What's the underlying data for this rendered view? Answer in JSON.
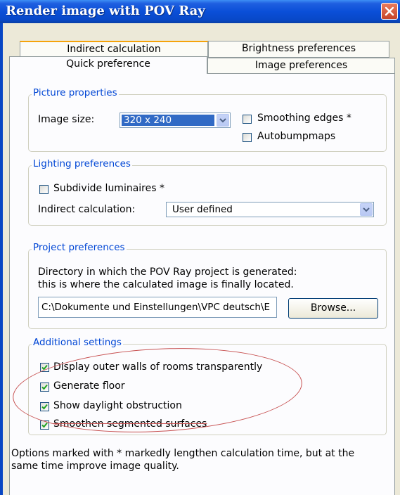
{
  "window": {
    "title": "Render image with POV Ray"
  },
  "tabs": {
    "row_back": [
      {
        "label": "Indirect calculation"
      },
      {
        "label": "Brightness preferences"
      }
    ],
    "row_front": [
      {
        "label": "Quick preference",
        "active": true
      },
      {
        "label": "Image preferences"
      }
    ]
  },
  "picture_properties": {
    "legend": "Picture properties",
    "image_size_label": "Image size:",
    "image_size_value": "320 x 240",
    "smoothing_edges": {
      "label": "Smoothing edges *",
      "checked": false
    },
    "autobumpmaps": {
      "label": "Autobumpmaps",
      "checked": false
    }
  },
  "lighting_preferences": {
    "legend": "Lighting preferences",
    "subdivide_luminaires": {
      "label": "Subdivide luminaires *",
      "checked": false
    },
    "indirect_calculation_label": "Indirect calculation:",
    "indirect_calculation_value": "User defined"
  },
  "project_preferences": {
    "legend": "Project preferences",
    "description_line1": "Directory in which the POV Ray project is generated:",
    "description_line2": "this is where the calculated image is finally located.",
    "directory_value": "C:\\Dokumente und Einstellungen\\VPC deutsch\\E",
    "browse_label": "Browse..."
  },
  "additional_settings": {
    "legend": "Additional settings",
    "items": [
      {
        "label": "Display outer walls of rooms transparently",
        "checked": true
      },
      {
        "label": "Generate floor",
        "checked": true
      },
      {
        "label": "Show daylight obstruction",
        "checked": true
      },
      {
        "label": "Smoothen segmented surfaces",
        "checked": true
      }
    ]
  },
  "footer_note": {
    "line1": "Options marked with * markedly lengthen calculation time, but at the",
    "line2": "same time improve image quality."
  },
  "colors": {
    "titlebar": "#0a4fd8",
    "dialog_bg": "#ece9d8",
    "panel_bg": "#fcfcfe",
    "legend_text": "#0046d5",
    "selection": "#316ac5",
    "check_mark": "#21a121",
    "annotation": "#c75050"
  }
}
